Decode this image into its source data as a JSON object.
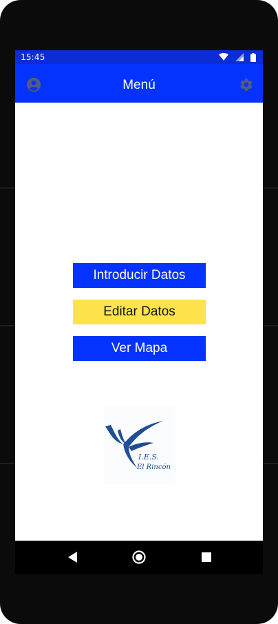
{
  "status_bar": {
    "time": "15:45",
    "icons": [
      "wifi-icon",
      "cell-signal-icon",
      "battery-icon"
    ]
  },
  "app_bar": {
    "title": "Menú",
    "left_icon": "account-circle-icon",
    "right_icon": "settings-gear-icon"
  },
  "menu": {
    "buttons": [
      {
        "label": "Introducir Datos",
        "color": "#0433ff"
      },
      {
        "label": "Editar Datos",
        "color": "#ffe34d"
      },
      {
        "label": "Ver Mapa",
        "color": "#0433ff"
      }
    ]
  },
  "logo": {
    "line1": "I.E.S.",
    "line2": "El Rincón",
    "color": "#1f4e96"
  },
  "nav_bar": {
    "icons": [
      "back-icon",
      "home-icon",
      "recents-icon"
    ]
  },
  "colors": {
    "primary": "#0433ff",
    "status_bar": "#0a2ed6",
    "accent_yellow": "#ffe34d",
    "icon_gray": "#5a5a7a"
  }
}
